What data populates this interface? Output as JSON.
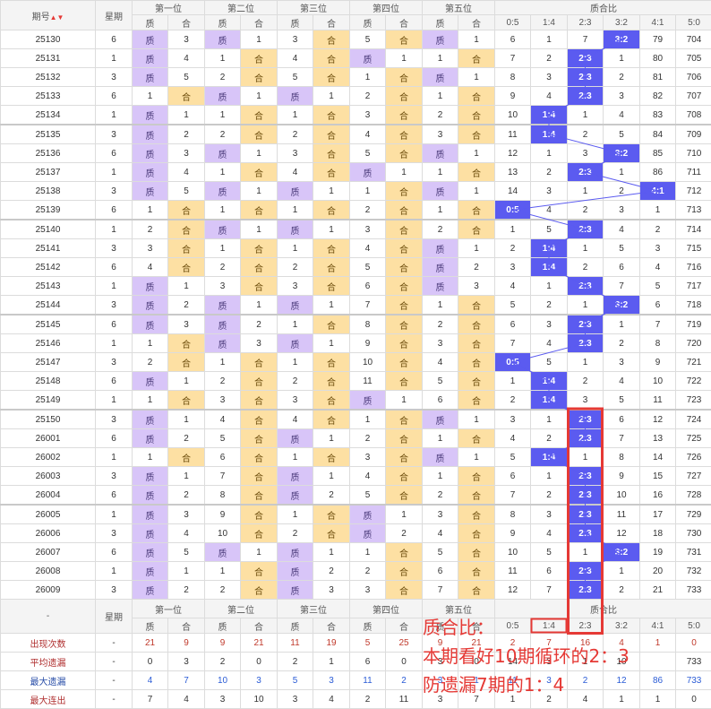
{
  "header": {
    "period_label": "期号",
    "weekday_label": "星期",
    "positions": [
      "第一位",
      "第二位",
      "第三位",
      "第四位",
      "第五位"
    ],
    "ratio_label": "质合比",
    "zhi": "质",
    "he": "合",
    "ratios": [
      "0:5",
      "1:4",
      "2:3",
      "3:2",
      "4:1",
      "5:0"
    ]
  },
  "rows": [
    {
      "p": "25130",
      "w": "6",
      "d": [
        [
          "质",
          "3"
        ],
        [
          "质",
          "1"
        ],
        [
          "3",
          "合"
        ],
        [
          "5",
          "合"
        ],
        [
          "质",
          "1"
        ]
      ],
      "r": [
        "6",
        "1",
        "7",
        "3:2",
        "79",
        "704"
      ],
      "h": 3
    },
    {
      "p": "25131",
      "w": "1",
      "d": [
        [
          "质",
          "4"
        ],
        [
          "1",
          "合"
        ],
        [
          "4",
          "合"
        ],
        [
          "质",
          "1"
        ],
        [
          "1",
          "合"
        ]
      ],
      "r": [
        "7",
        "2",
        "2:3",
        "1",
        "80",
        "705"
      ],
      "h": 2
    },
    {
      "p": "25132",
      "w": "3",
      "d": [
        [
          "质",
          "5"
        ],
        [
          "2",
          "合"
        ],
        [
          "5",
          "合"
        ],
        [
          "1",
          "合"
        ],
        [
          "质",
          "1"
        ]
      ],
      "r": [
        "8",
        "3",
        "2:3",
        "2",
        "81",
        "706"
      ],
      "h": 2
    },
    {
      "p": "25133",
      "w": "6",
      "d": [
        [
          "1",
          "合"
        ],
        [
          "质",
          "1"
        ],
        [
          "质",
          "1"
        ],
        [
          "2",
          "合"
        ],
        [
          "1",
          "合"
        ]
      ],
      "r": [
        "9",
        "4",
        "2:3",
        "3",
        "82",
        "707"
      ],
      "h": 2
    },
    {
      "p": "25134",
      "w": "1",
      "d": [
        [
          "质",
          "1"
        ],
        [
          "1",
          "合"
        ],
        [
          "1",
          "合"
        ],
        [
          "3",
          "合"
        ],
        [
          "2",
          "合"
        ]
      ],
      "r": [
        "10",
        "1:4",
        "1",
        "4",
        "83",
        "708"
      ],
      "h": 1
    },
    {
      "p": "25135",
      "w": "3",
      "d": [
        [
          "质",
          "2"
        ],
        [
          "2",
          "合"
        ],
        [
          "2",
          "合"
        ],
        [
          "4",
          "合"
        ],
        [
          "3",
          "合"
        ]
      ],
      "r": [
        "11",
        "1:4",
        "2",
        "5",
        "84",
        "709"
      ],
      "h": 1
    },
    {
      "p": "25136",
      "w": "6",
      "d": [
        [
          "质",
          "3"
        ],
        [
          "质",
          "1"
        ],
        [
          "3",
          "合"
        ],
        [
          "5",
          "合"
        ],
        [
          "质",
          "1"
        ]
      ],
      "r": [
        "12",
        "1",
        "3",
        "3:2",
        "85",
        "710"
      ],
      "h": 3
    },
    {
      "p": "25137",
      "w": "1",
      "d": [
        [
          "质",
          "4"
        ],
        [
          "1",
          "合"
        ],
        [
          "4",
          "合"
        ],
        [
          "质",
          "1"
        ],
        [
          "1",
          "合"
        ]
      ],
      "r": [
        "13",
        "2",
        "2:3",
        "1",
        "86",
        "711"
      ],
      "h": 2
    },
    {
      "p": "25138",
      "w": "3",
      "d": [
        [
          "质",
          "5"
        ],
        [
          "质",
          "1"
        ],
        [
          "质",
          "1"
        ],
        [
          "1",
          "合"
        ],
        [
          "质",
          "1"
        ]
      ],
      "r": [
        "14",
        "3",
        "1",
        "2",
        "4:1",
        "712"
      ],
      "h": 4
    },
    {
      "p": "25139",
      "w": "6",
      "d": [
        [
          "1",
          "合"
        ],
        [
          "1",
          "合"
        ],
        [
          "1",
          "合"
        ],
        [
          "2",
          "合"
        ],
        [
          "1",
          "合"
        ]
      ],
      "r": [
        "0:5",
        "4",
        "2",
        "3",
        "1",
        "713"
      ],
      "h": 0
    },
    {
      "p": "25140",
      "w": "1",
      "d": [
        [
          "2",
          "合"
        ],
        [
          "质",
          "1"
        ],
        [
          "质",
          "1"
        ],
        [
          "3",
          "合"
        ],
        [
          "2",
          "合"
        ]
      ],
      "r": [
        "1",
        "5",
        "2:3",
        "4",
        "2",
        "714"
      ],
      "h": 2
    },
    {
      "p": "25141",
      "w": "3",
      "d": [
        [
          "3",
          "合"
        ],
        [
          "1",
          "合"
        ],
        [
          "1",
          "合"
        ],
        [
          "4",
          "合"
        ],
        [
          "质",
          "1"
        ]
      ],
      "r": [
        "2",
        "1:4",
        "1",
        "5",
        "3",
        "715"
      ],
      "h": 1
    },
    {
      "p": "25142",
      "w": "6",
      "d": [
        [
          "4",
          "合"
        ],
        [
          "2",
          "合"
        ],
        [
          "2",
          "合"
        ],
        [
          "5",
          "合"
        ],
        [
          "质",
          "2"
        ]
      ],
      "r": [
        "3",
        "1:4",
        "2",
        "6",
        "4",
        "716"
      ],
      "h": 1
    },
    {
      "p": "25143",
      "w": "1",
      "d": [
        [
          "质",
          "1"
        ],
        [
          "3",
          "合"
        ],
        [
          "3",
          "合"
        ],
        [
          "6",
          "合"
        ],
        [
          "质",
          "3"
        ]
      ],
      "r": [
        "4",
        "1",
        "2:3",
        "7",
        "5",
        "717"
      ],
      "h": 2
    },
    {
      "p": "25144",
      "w": "3",
      "d": [
        [
          "质",
          "2"
        ],
        [
          "质",
          "1"
        ],
        [
          "质",
          "1"
        ],
        [
          "7",
          "合"
        ],
        [
          "1",
          "合"
        ]
      ],
      "r": [
        "5",
        "2",
        "1",
        "3:2",
        "6",
        "718"
      ],
      "h": 3
    },
    {
      "p": "25145",
      "w": "6",
      "d": [
        [
          "质",
          "3"
        ],
        [
          "质",
          "2"
        ],
        [
          "1",
          "合"
        ],
        [
          "8",
          "合"
        ],
        [
          "2",
          "合"
        ]
      ],
      "r": [
        "6",
        "3",
        "2:3",
        "1",
        "7",
        "719"
      ],
      "h": 2
    },
    {
      "p": "25146",
      "w": "1",
      "d": [
        [
          "1",
          "合"
        ],
        [
          "质",
          "3"
        ],
        [
          "质",
          "1"
        ],
        [
          "9",
          "合"
        ],
        [
          "3",
          "合"
        ]
      ],
      "r": [
        "7",
        "4",
        "2:3",
        "2",
        "8",
        "720"
      ],
      "h": 2
    },
    {
      "p": "25147",
      "w": "3",
      "d": [
        [
          "2",
          "合"
        ],
        [
          "1",
          "合"
        ],
        [
          "1",
          "合"
        ],
        [
          "10",
          "合"
        ],
        [
          "4",
          "合"
        ]
      ],
      "r": [
        "0:5",
        "5",
        "1",
        "3",
        "9",
        "721"
      ],
      "h": 0
    },
    {
      "p": "25148",
      "w": "6",
      "d": [
        [
          "质",
          "1"
        ],
        [
          "2",
          "合"
        ],
        [
          "2",
          "合"
        ],
        [
          "11",
          "合"
        ],
        [
          "5",
          "合"
        ]
      ],
      "r": [
        "1",
        "1:4",
        "2",
        "4",
        "10",
        "722"
      ],
      "h": 1
    },
    {
      "p": "25149",
      "w": "1",
      "d": [
        [
          "1",
          "合"
        ],
        [
          "3",
          "合"
        ],
        [
          "3",
          "合"
        ],
        [
          "质",
          "1"
        ],
        [
          "6",
          "合"
        ]
      ],
      "r": [
        "2",
        "1:4",
        "3",
        "5",
        "11",
        "723"
      ],
      "h": 1
    },
    {
      "p": "25150",
      "w": "3",
      "d": [
        [
          "质",
          "1"
        ],
        [
          "4",
          "合"
        ],
        [
          "4",
          "合"
        ],
        [
          "1",
          "合"
        ],
        [
          "质",
          "1"
        ]
      ],
      "r": [
        "3",
        "1",
        "2:3",
        "6",
        "12",
        "724"
      ],
      "h": 2
    },
    {
      "p": "26001",
      "w": "6",
      "d": [
        [
          "质",
          "2"
        ],
        [
          "5",
          "合"
        ],
        [
          "质",
          "1"
        ],
        [
          "2",
          "合"
        ],
        [
          "1",
          "合"
        ]
      ],
      "r": [
        "4",
        "2",
        "2:3",
        "7",
        "13",
        "725"
      ],
      "h": 2
    },
    {
      "p": "26002",
      "w": "1",
      "d": [
        [
          "1",
          "合"
        ],
        [
          "6",
          "合"
        ],
        [
          "1",
          "合"
        ],
        [
          "3",
          "合"
        ],
        [
          "质",
          "1"
        ]
      ],
      "r": [
        "5",
        "1:4",
        "1",
        "8",
        "14",
        "726"
      ],
      "h": 1
    },
    {
      "p": "26003",
      "w": "3",
      "d": [
        [
          "质",
          "1"
        ],
        [
          "7",
          "合"
        ],
        [
          "质",
          "1"
        ],
        [
          "4",
          "合"
        ],
        [
          "1",
          "合"
        ]
      ],
      "r": [
        "6",
        "1",
        "2:3",
        "9",
        "15",
        "727"
      ],
      "h": 2
    },
    {
      "p": "26004",
      "w": "6",
      "d": [
        [
          "质",
          "2"
        ],
        [
          "8",
          "合"
        ],
        [
          "质",
          "2"
        ],
        [
          "5",
          "合"
        ],
        [
          "2",
          "合"
        ]
      ],
      "r": [
        "7",
        "2",
        "2:3",
        "10",
        "16",
        "728"
      ],
      "h": 2
    },
    {
      "p": "26005",
      "w": "1",
      "d": [
        [
          "质",
          "3"
        ],
        [
          "9",
          "合"
        ],
        [
          "1",
          "合"
        ],
        [
          "质",
          "1"
        ],
        [
          "3",
          "合"
        ]
      ],
      "r": [
        "8",
        "3",
        "2:3",
        "11",
        "17",
        "729"
      ],
      "h": 2
    },
    {
      "p": "26006",
      "w": "3",
      "d": [
        [
          "质",
          "4"
        ],
        [
          "10",
          "合"
        ],
        [
          "2",
          "合"
        ],
        [
          "质",
          "2"
        ],
        [
          "4",
          "合"
        ]
      ],
      "r": [
        "9",
        "4",
        "2:3",
        "12",
        "18",
        "730"
      ],
      "h": 2
    },
    {
      "p": "26007",
      "w": "6",
      "d": [
        [
          "质",
          "5"
        ],
        [
          "质",
          "1"
        ],
        [
          "质",
          "1"
        ],
        [
          "1",
          "合"
        ],
        [
          "5",
          "合"
        ]
      ],
      "r": [
        "10",
        "5",
        "1",
        "3:2",
        "19",
        "731"
      ],
      "h": 3
    },
    {
      "p": "26008",
      "w": "1",
      "d": [
        [
          "质",
          "1"
        ],
        [
          "1",
          "合"
        ],
        [
          "质",
          "2"
        ],
        [
          "2",
          "合"
        ],
        [
          "6",
          "合"
        ]
      ],
      "r": [
        "11",
        "6",
        "2:3",
        "1",
        "20",
        "732"
      ],
      "h": 2
    },
    {
      "p": "26009",
      "w": "3",
      "d": [
        [
          "质",
          "2"
        ],
        [
          "2",
          "合"
        ],
        [
          "质",
          "3"
        ],
        [
          "3",
          "合"
        ],
        [
          "7",
          "合"
        ]
      ],
      "r": [
        "12",
        "7",
        "2:3",
        "2",
        "21",
        "733"
      ],
      "h": 2
    }
  ],
  "footer": {
    "dash": "-",
    "weekday_label": "星期",
    "stats": [
      {
        "label": "出现次数",
        "w": "-",
        "v": [
          "21",
          "9",
          "9",
          "21",
          "11",
          "19",
          "5",
          "25",
          "9",
          "21",
          "2",
          "7",
          "16",
          "4",
          "1",
          "0"
        ]
      },
      {
        "label": "平均遗漏",
        "w": "-",
        "v": [
          "0",
          "3",
          "2",
          "0",
          "2",
          "1",
          "6",
          "0",
          "3",
          "0",
          "14",
          "3",
          "1",
          "10",
          "",
          "733"
        ]
      },
      {
        "label": "最大遗漏",
        "w": "-",
        "v": [
          "4",
          "7",
          "10",
          "3",
          "5",
          "3",
          "11",
          "2",
          "3",
          "1",
          "11",
          "3",
          "2",
          "12",
          "86",
          "733"
        ]
      },
      {
        "label": "最大连出",
        "w": "-",
        "v": [
          "7",
          "4",
          "3",
          "10",
          "3",
          "4",
          "2",
          "11",
          "3",
          "7",
          "1",
          "2",
          "4",
          "1",
          "1",
          "0"
        ]
      }
    ]
  },
  "annotation": {
    "line1": "质合比：",
    "line2": "本期看好10期循环的2：3",
    "line3": "防遗漏7期的1：4"
  },
  "colors": {
    "zhi": "#d8c5f8",
    "he": "#fde0a3",
    "hit": "#5b5bf0",
    "annotation": "#e53935"
  }
}
